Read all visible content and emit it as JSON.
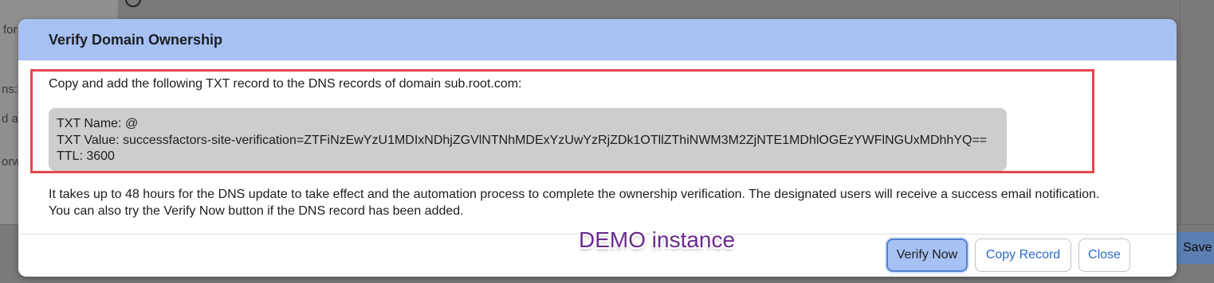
{
  "background": {
    "fragments": [
      "for",
      "ns:",
      "d a",
      "orwa"
    ],
    "save_label": "Save"
  },
  "dialog": {
    "title": "Verify Domain Ownership",
    "intro": "Copy and add the following TXT record to the DNS records of domain sub.root.com:",
    "record": {
      "name_line": "TXT Name: @",
      "value_line": "TXT Value: successfactors-site-verification=ZTFiNzEwYzU1MDIxNDhjZGVlNTNhMDExYzUwYzRjZDk1OTllZThiNWM3M2ZjNTE1MDhlOGEzYWFlNGUxMDhhYQ==",
      "ttl_line": "TTL: 3600"
    },
    "note_line1": "It takes up to 48 hours for the DNS update to take effect and the automation process to complete the ownership verification. The designated users will receive a success email notification.",
    "note_line2": "You can also try the Verify Now button if the DNS record has been added.",
    "watermark": "DEMO instance",
    "buttons": {
      "verify": "Verify Now",
      "copy": "Copy Record",
      "close": "Close"
    }
  },
  "colors": {
    "header": "#a7c1f5",
    "highlight": "#e5484d",
    "link": "#2e6acb",
    "watermark": "#6a2c8c"
  }
}
